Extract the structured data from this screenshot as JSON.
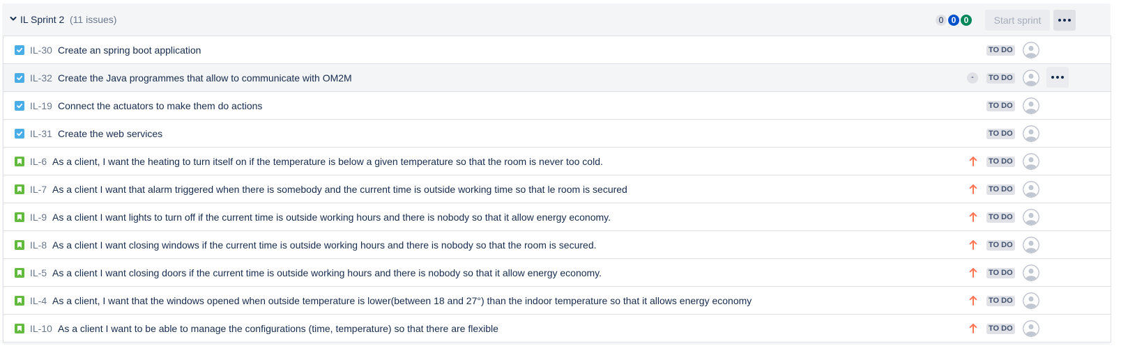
{
  "sprint": {
    "name": "IL Sprint 2",
    "issue_count": "(11 issues)",
    "counts": {
      "todo": "0",
      "in_progress": "0",
      "done": "0"
    },
    "start_button_label": "Start sprint",
    "more_icon": "more-horizontal-icon",
    "collapse_icon": "chevron-down-icon"
  },
  "colors": {
    "task_type": "#4bade8",
    "story_type": "#63ba3c",
    "in_progress_count": "#0052cc",
    "done_count": "#00875a",
    "priority_high": "#ff7452"
  },
  "issues": [
    {
      "key": "IL-30",
      "summary": "Create an spring boot application",
      "type": "task",
      "priority": "",
      "estimate": "",
      "status": "TO DO"
    },
    {
      "key": "IL-32",
      "summary": "Create the Java programmes that allow to communicate with OM2M",
      "type": "task",
      "priority": "",
      "estimate": "-",
      "status": "TO DO"
    },
    {
      "key": "IL-19",
      "summary": "Connect the actuators to make them do actions",
      "type": "task",
      "priority": "",
      "estimate": "",
      "status": "TO DO"
    },
    {
      "key": "IL-31",
      "summary": "Create the web services",
      "type": "task",
      "priority": "",
      "estimate": "",
      "status": "TO DO"
    },
    {
      "key": "IL-6",
      "summary": "As a client, I want the heating to turn itself on if the temperature is below a given temperature so that the room is never too cold.",
      "type": "story",
      "priority": "high",
      "estimate": "",
      "status": "TO DO"
    },
    {
      "key": "IL-7",
      "summary": "As a client I want that alarm triggered when there is somebody and the current time is outside working time so that le room is secured",
      "type": "story",
      "priority": "high",
      "estimate": "",
      "status": "TO DO"
    },
    {
      "key": "IL-9",
      "summary": "As a client I want lights to turn off if the current time is outside working hours and there is nobody so that it allow energy economy.",
      "type": "story",
      "priority": "high",
      "estimate": "",
      "status": "TO DO"
    },
    {
      "key": "IL-8",
      "summary": "As a client I want closing windows if the current time is outside working hours and there is nobody so that the room is secured.",
      "type": "story",
      "priority": "high",
      "estimate": "",
      "status": "TO DO"
    },
    {
      "key": "IL-5",
      "summary": "As a client I want closing doors if the current time is outside working hours and there is nobody so that it allow energy economy.",
      "type": "story",
      "priority": "high",
      "estimate": "",
      "status": "TO DO"
    },
    {
      "key": "IL-4",
      "summary": "As a client, I want that the windows opened when outside temperature is lower(between 18 and 27°) than the indoor temperature so that it allows energy economy",
      "type": "story",
      "priority": "high",
      "estimate": "",
      "status": "TO DO"
    },
    {
      "key": "IL-10",
      "summary": "As a client I want to be able to manage the configurations (time, temperature) so that there are flexible",
      "type": "story",
      "priority": "high",
      "estimate": "",
      "status": "TO DO"
    }
  ]
}
